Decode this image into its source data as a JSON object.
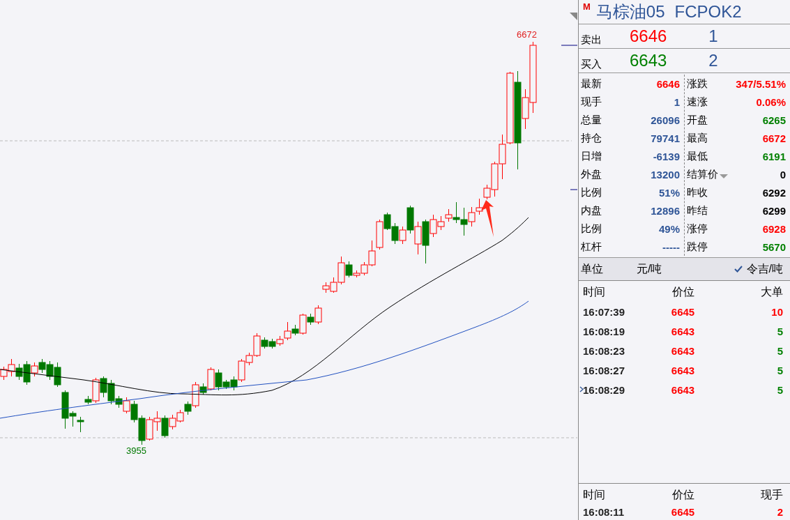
{
  "chart": {
    "high_label": "6672",
    "low_label": "3955"
  },
  "instrument": {
    "exchange_mark": "M",
    "name": "马棕油05",
    "code": "FCPOK2"
  },
  "quotes": [
    {
      "label": "卖出",
      "price": "6646",
      "volume": "1",
      "kind": "sell"
    },
    {
      "label": "买入",
      "price": "6643",
      "volume": "2",
      "kind": "buy"
    }
  ],
  "stats_left": [
    {
      "label": "最新",
      "value": "6646",
      "color": "#ff0000"
    },
    {
      "label": "现手",
      "value": "1",
      "color": "#2f5597"
    },
    {
      "label": "总量",
      "value": "26096",
      "color": "#2f5597"
    },
    {
      "label": "持仓",
      "value": "79741",
      "color": "#2f5597"
    },
    {
      "label": "日增",
      "value": "-6139",
      "color": "#2f5597"
    },
    {
      "label": "外盘",
      "value": "13200",
      "color": "#2f5597"
    },
    {
      "label": "比例",
      "value": "51%",
      "color": "#2f5597"
    },
    {
      "label": "内盘",
      "value": "12896",
      "color": "#2f5597"
    },
    {
      "label": "比例",
      "value": "49%",
      "color": "#2f5597"
    },
    {
      "label": "杠杆",
      "value": "-----",
      "color": "#2f5597"
    }
  ],
  "stats_right": [
    {
      "label": "涨跌",
      "value": "347/5.51%",
      "color": "#ff0000"
    },
    {
      "label": "速涨",
      "value": "0.06%",
      "color": "#ff0000"
    },
    {
      "label": "开盘",
      "value": "6265",
      "color": "#008000"
    },
    {
      "label": "最高",
      "value": "6672",
      "color": "#ff0000"
    },
    {
      "label": "最低",
      "value": "6191",
      "color": "#008000"
    },
    {
      "label": "结算价",
      "value": "0",
      "color": "#000000",
      "dropdown": true
    },
    {
      "label": "昨收",
      "value": "6292",
      "color": "#000000"
    },
    {
      "label": "昨结",
      "value": "6299",
      "color": "#000000"
    },
    {
      "label": "涨停",
      "value": "6928",
      "color": "#ff0000"
    },
    {
      "label": "跌停",
      "value": "5670",
      "color": "#008000"
    }
  ],
  "unit": {
    "label": "单位",
    "value": "元/吨",
    "option": "令吉/吨",
    "checked": true
  },
  "big_orders": {
    "columns": [
      "时间",
      "价位",
      "大单"
    ],
    "rows": [
      {
        "time": "16:07:39",
        "price": "6645",
        "size": "10",
        "price_up": true,
        "size_up": true,
        "current": false
      },
      {
        "time": "16:08:19",
        "price": "6643",
        "size": "5",
        "price_up": true,
        "size_up": false,
        "current": false
      },
      {
        "time": "16:08:23",
        "price": "6643",
        "size": "5",
        "price_up": true,
        "size_up": false,
        "current": false
      },
      {
        "time": "16:08:27",
        "price": "6643",
        "size": "5",
        "price_up": true,
        "size_up": false,
        "current": false
      },
      {
        "time": "16:08:29",
        "price": "6643",
        "size": "5",
        "price_up": true,
        "size_up": false,
        "current": true
      }
    ]
  },
  "ticks": {
    "columns": [
      "时间",
      "价位",
      "现手"
    ],
    "rows": [
      {
        "time": "16:08:11",
        "price": "6645",
        "size": "2",
        "price_up": true,
        "size_up": true
      }
    ]
  }
}
